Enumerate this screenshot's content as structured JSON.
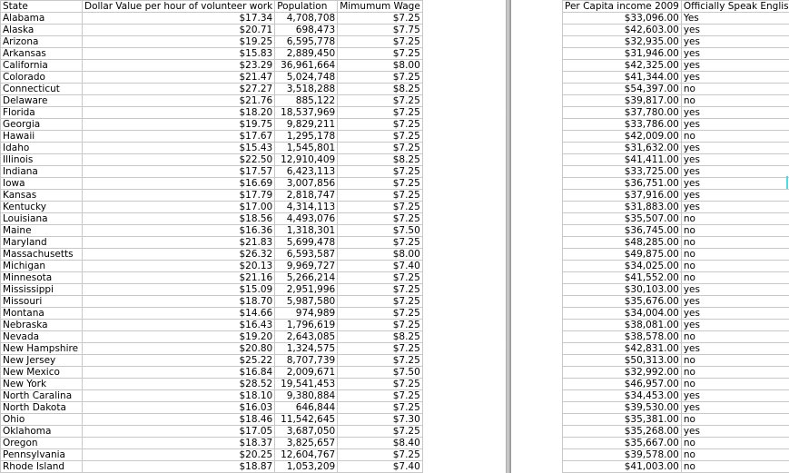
{
  "left_table": {
    "headers": [
      "State",
      "Dollar Value per hour of volunteer work",
      "Population",
      "Mimumum Wage"
    ],
    "rows": [
      [
        "Alabama",
        "$17.34",
        "4,708,708",
        "$7.25"
      ],
      [
        "Alaska",
        "$20.71",
        "698,473",
        "$7.75"
      ],
      [
        "Arizona",
        "$19.25",
        "6,595,778",
        "$7.25"
      ],
      [
        "Arkansas",
        "$15.83",
        "2,889,450",
        "$7.25"
      ],
      [
        "California",
        "$23.29",
        "36,961,664",
        "$8.00"
      ],
      [
        "Colorado",
        "$21.47",
        "5,024,748",
        "$7.25"
      ],
      [
        "Connecticut",
        "$27.27",
        "3,518,288",
        "$8.25"
      ],
      [
        "Delaware",
        "$21.76",
        "885,122",
        "$7.25"
      ],
      [
        "Florida",
        "$18.20",
        "18,537,969",
        "$7.25"
      ],
      [
        "Georgia",
        "$19.75",
        "9,829,211",
        "$7.25"
      ],
      [
        "Hawaii",
        "$17.67",
        "1,295,178",
        "$7.25"
      ],
      [
        "Idaho",
        "$15.43",
        "1,545,801",
        "$7.25"
      ],
      [
        "Illinois",
        "$22.50",
        "12,910,409",
        "$8.25"
      ],
      [
        "Indiana",
        "$17.57",
        "6,423,113",
        "$7.25"
      ],
      [
        "Iowa",
        "$16.69",
        "3,007,856",
        "$7.25"
      ],
      [
        "Kansas",
        "$17.79",
        "2,818,747",
        "$7.25"
      ],
      [
        "Kentucky",
        "$17.00",
        "4,314,113",
        "$7.25"
      ],
      [
        "Louisiana",
        "$18.56",
        "4,493,076",
        "$7.25"
      ],
      [
        "Maine",
        "$16.36",
        "1,318,301",
        "$7.50"
      ],
      [
        "Maryland",
        "$21.83",
        "5,699,478",
        "$7.25"
      ],
      [
        "Massachusetts",
        "$26.32",
        "6,593,587",
        "$8.00"
      ],
      [
        "Michigan",
        "$20.13",
        "9,969,727",
        "$7.40"
      ],
      [
        "Minnesota",
        "$21.16",
        "5,266,214",
        "$7.25"
      ],
      [
        "Mississippi",
        "$15.09",
        "2,951,996",
        "$7.25"
      ],
      [
        "Missouri",
        "$18.70",
        "5,987,580",
        "$7.25"
      ],
      [
        "Montana",
        "$14.66",
        "974,989",
        "$7.25"
      ],
      [
        "Nebraska",
        "$16.43",
        "1,796,619",
        "$7.25"
      ],
      [
        "Nevada",
        "$19.20",
        "2,643,085",
        "$8.25"
      ],
      [
        "New Hampshire",
        "$20.80",
        "1,324,575",
        "$7.25"
      ],
      [
        "New Jersey",
        "$25.22",
        "8,707,739",
        "$7.25"
      ],
      [
        "New Mexico",
        "$16.84",
        "2,009,671",
        "$7.50"
      ],
      [
        "New York",
        "$28.52",
        "19,541,453",
        "$7.25"
      ],
      [
        "North Caralina",
        "$18.10",
        "9,380,884",
        "$7.25"
      ],
      [
        "North Dakota",
        "$16.03",
        "646,844",
        "$7.25"
      ],
      [
        "Ohio",
        "$18.46",
        "11,542,645",
        "$7.30"
      ],
      [
        "Oklahoma",
        "$17.05",
        "3,687,050",
        "$7.25"
      ],
      [
        "Oregon",
        "$18.37",
        "3,825,657",
        "$8.40"
      ],
      [
        "Pennsylvania",
        "$20.25",
        "12,604,767",
        "$7.25"
      ],
      [
        "Rhode Island",
        "$18.87",
        "1,053,209",
        "$7.40"
      ]
    ]
  },
  "right_table": {
    "headers": [
      "Per Capita income 2009",
      "Officially Speak English"
    ],
    "rows": [
      [
        "$33,096.00",
        "Yes"
      ],
      [
        "$42,603.00",
        "yes"
      ],
      [
        "$32,935.00",
        "yes"
      ],
      [
        "$31,946.00",
        "yes"
      ],
      [
        "$42,325.00",
        "yes"
      ],
      [
        "$41,344.00",
        "yes"
      ],
      [
        "$54,397.00",
        "no"
      ],
      [
        "$39,817.00",
        "no"
      ],
      [
        "$37,780.00",
        "yes"
      ],
      [
        "$33,786.00",
        "yes"
      ],
      [
        "$42,009.00",
        "no"
      ],
      [
        "$31,632.00",
        "yes"
      ],
      [
        "$41,411.00",
        "yes"
      ],
      [
        "$33,725.00",
        "yes"
      ],
      [
        "$36,751.00",
        "yes"
      ],
      [
        "$37,916.00",
        "yes"
      ],
      [
        "$31,883.00",
        "yes"
      ],
      [
        "$35,507.00",
        "no"
      ],
      [
        "$36,745.00",
        "no"
      ],
      [
        "$48,285.00",
        "no"
      ],
      [
        "$49,875.00",
        "no"
      ],
      [
        "$34,025.00",
        "no"
      ],
      [
        "$41,552.00",
        "no"
      ],
      [
        "$30,103.00",
        "yes"
      ],
      [
        "$35,676.00",
        "yes"
      ],
      [
        "$34,004.00",
        "yes"
      ],
      [
        "$38,081.00",
        "yes"
      ],
      [
        "$38,578.00",
        "no"
      ],
      [
        "$42,831.00",
        "yes"
      ],
      [
        "$50,313.00",
        "no"
      ],
      [
        "$32,992.00",
        "no"
      ],
      [
        "$46,957.00",
        "no"
      ],
      [
        "$34,453.00",
        "yes"
      ],
      [
        "$39,530.00",
        "yes"
      ],
      [
        "$35,381.00",
        "no"
      ],
      [
        "$35,268.00",
        "yes"
      ],
      [
        "$35,667.00",
        "no"
      ],
      [
        "$39,578.00",
        "no"
      ],
      [
        "$41,003.00",
        "no"
      ]
    ]
  },
  "colors": {
    "grid_line": "#c8c8c8",
    "cell_cursor": "#4fd8e8"
  }
}
